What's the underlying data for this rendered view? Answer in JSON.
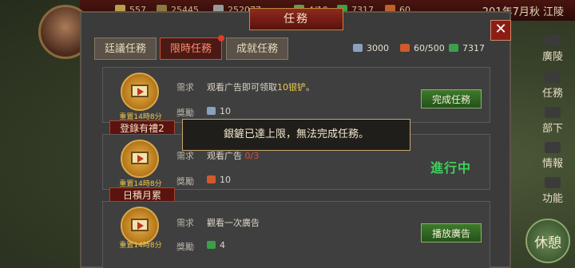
{
  "top_bar": {
    "resources": [
      {
        "value": "557",
        "icon": "gold-icon",
        "color": "#b8a04a"
      },
      {
        "value": "25445",
        "icon": "food-icon",
        "color": "#8a7a40"
      },
      {
        "value": "252077",
        "icon": "silver-icon",
        "color": "#9a9a9a"
      },
      {
        "value": "4/10",
        "icon": "troops-icon",
        "color": "#6a9a4a"
      },
      {
        "value": "7317",
        "icon": "jade-icon",
        "color": "#3aa04a"
      },
      {
        "value": "60",
        "icon": "token-icon",
        "color": "#c0602a"
      }
    ],
    "date": "201年7月秋 江陵"
  },
  "side_menu": [
    {
      "label": "廣陵",
      "icon": "city-icon"
    },
    {
      "label": "任務",
      "icon": "quest-icon"
    },
    {
      "label": "部下",
      "icon": "officer-icon"
    },
    {
      "label": "情報",
      "icon": "intel-icon"
    },
    {
      "label": "功能",
      "icon": "gear-icon"
    }
  ],
  "rest_button": "休憩",
  "panel": {
    "title": "任務",
    "close": "✕",
    "tabs": [
      {
        "label": "廷議任務",
        "active": false
      },
      {
        "label": "限時任務",
        "active": true
      },
      {
        "label": "成就任務",
        "active": false
      }
    ],
    "stats": [
      {
        "value": "3000",
        "icon": "shovel-icon",
        "color": "#8aa0c0"
      },
      {
        "value": "60/500",
        "icon": "token-icon",
        "color": "#d05a2a"
      },
      {
        "value": "7317",
        "icon": "jade-icon",
        "color": "#3aa04a"
      }
    ],
    "tasks": [
      {
        "name": "登錄有禮2",
        "reset": "重置14時8分",
        "req_label": "需求",
        "req_text": "观看广告即可领取",
        "req_highlight": "10银铲",
        "req_suffix": "。",
        "reward_label": "獎勵",
        "reward_value": "10",
        "reward_icon": "shovel-icon",
        "action": "完成任務"
      },
      {
        "name": "日積月累",
        "reset": "重置14時8分",
        "req_label": "需求",
        "req_text": "观看广告",
        "req_progress": "0/3",
        "reward_label": "獎勵",
        "reward_value": "10",
        "reward_icon": "token-icon",
        "status": "進行中"
      },
      {
        "name": "",
        "reset": "重置14時8分",
        "req_label": "需求",
        "req_text": "觀看一次廣告",
        "reward_label": "獎勵",
        "reward_value": "4",
        "reward_icon": "jade-icon",
        "action": "播放廣告"
      }
    ]
  },
  "toast": "銀鏟已達上限，無法完成任務。"
}
